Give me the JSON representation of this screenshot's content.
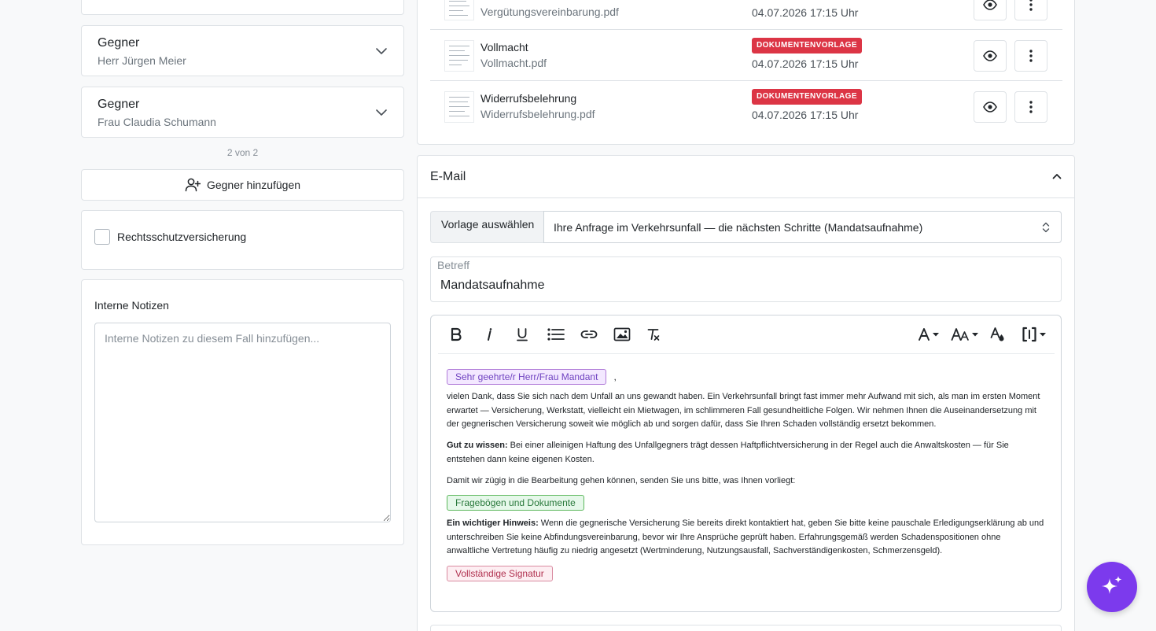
{
  "opponents": [
    {
      "label": "Gegner",
      "name": "Herr Jürgen Meier"
    },
    {
      "label": "Gegner",
      "name": "Frau Claudia Schumann"
    }
  ],
  "opponent_counter": "2 von 2",
  "add_opponent_label": "Gegner hinzufügen",
  "legal_insurance_label": "Rechtsschutzversicherung",
  "notes": {
    "title": "Interne Notizen",
    "placeholder": "Interne Notizen zu diesem Fall hinzufügen..."
  },
  "documents": [
    {
      "file": "Vergütungsvereinbarung.pdf",
      "time": "04.07.2026 17:15 Uhr"
    },
    {
      "name": "Vollmacht",
      "file": "Vollmacht.pdf",
      "badge": "DOKUMENTENVORLAGE",
      "time": "04.07.2026 17:15 Uhr"
    },
    {
      "name": "Widerrufsbelehrung",
      "file": "Widerrufsbelehrung.pdf",
      "badge": "DOKUMENTENVORLAGE",
      "time": "04.07.2026 17:15 Uhr"
    }
  ],
  "email": {
    "section_title": "E-Mail",
    "template_label": "Vorlage auswählen",
    "template_value": "Ihre Anfrage im Verkehrsunfall — die nächsten Schritte (Mandatsaufnahme)",
    "subject_label": "Betreff",
    "subject_value": "Mandatsaufnahme",
    "body": {
      "salutation_tag": "Sehr geehrte/r Herr/Frau Mandant",
      "salutation_suffix": ",",
      "p1": "vielen Dank, dass Sie sich nach dem Unfall an uns gewandt haben. Ein Verkehrsunfall bringt fast immer mehr Aufwand mit sich, als man im ersten Moment erwartet — Versicherung, Werkstatt, vielleicht ein Mietwagen, im schlimmeren Fall gesundheitliche Folgen. Wir nehmen Ihnen die Auseinandersetzung mit der gegnerischen Versicherung soweit wie möglich ab und sorgen dafür, dass Sie Ihren Schaden vollständig ersetzt bekommen.",
      "p2_bold": "Gut zu wissen:",
      "p2": " Bei einer alleinigen Haftung des Unfallgegners trägt dessen Haftpflichtversicherung in der Regel auch die Anwaltskosten — für Sie entstehen dann keine eigenen Kosten.",
      "p3": "Damit wir zügig in die Bearbeitung gehen können, senden Sie uns bitte, was Ihnen vorliegt:",
      "questionnaire_tag": "Fragebögen und Dokumente",
      "p4_bold": "Ein wichtiger Hinweis:",
      "p4": " Wenn die gegnerische Versicherung Sie bereits direkt kontaktiert hat, geben Sie bitte keine pauschale Erledigungserklärung ab und unterschreiben Sie keine Abfindungsvereinbarung, bevor wir Ihre Ansprüche geprüft haben. Erfahrungsgemäß werden Schadenspositionen ohne anwaltliche Vertretung häufig zu niedrig angesetzt (Wertminderung, Nutzungsausfall, Sachverständigenkosten, Schmerzensgeld).",
      "signature_tag": "Vollständige Signatur"
    }
  },
  "colors": {
    "badge": "#dc3545",
    "fab": "#7c3aed",
    "tag_purple": "#6f42c1",
    "tag_green": "#2b7a3d",
    "tag_pink": "#b0304f"
  },
  "icons": [
    "chevron-down-icon",
    "user-plus-icon",
    "eye-icon",
    "more-vertical-icon",
    "chevron-up-icon",
    "sort-icon",
    "bold-icon",
    "italic-icon",
    "underline-icon",
    "bullet-list-icon",
    "link-icon",
    "image-icon",
    "clear-format-icon",
    "font-family-icon",
    "font-size-icon",
    "text-color-icon",
    "placeholder-icon",
    "sparkle-icon"
  ]
}
